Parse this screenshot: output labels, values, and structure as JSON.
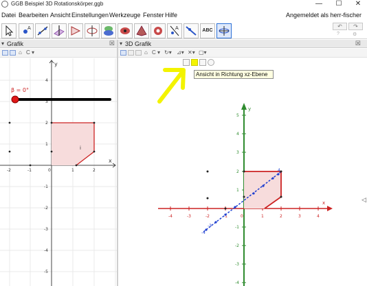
{
  "window": {
    "title": "GGB Beispiel 3D Rotationskörper.ggb",
    "minimize": "—",
    "maximize": "☐",
    "close": "✕"
  },
  "menu": {
    "items": [
      "Datei",
      "Bearbeiten",
      "Ansicht",
      "Einstellungen",
      "Werkzeuge",
      "Fenster",
      "Hilfe"
    ],
    "login": "Angemeldet als herr-fischer"
  },
  "toolbar": {
    "tools": [
      "move-tool",
      "point-tool",
      "line-tool",
      "perpendicular-tool",
      "polygon-tool",
      "circle-tool",
      "intersect-planes-tool",
      "sphere-tool",
      "pyramid-tool",
      "rotate-view-tool",
      "reflect-tool",
      "slider-tool",
      "text-tool",
      "view-rotate-tool"
    ],
    "text_tool_label": "ABC",
    "undo": "↶",
    "redo": "↷"
  },
  "left_panel": {
    "title": "Grafik",
    "style_label": "C",
    "slider_label": "β = 0°",
    "polygon_label": "i",
    "axis_x_label": "x",
    "axis_y_label": "y",
    "x_ticks": [
      "-2",
      "-1",
      "0",
      "1",
      "2"
    ],
    "y_ticks": [
      "4",
      "3",
      "2",
      "1",
      "-1",
      "-2",
      "-3",
      "-4",
      "-5"
    ]
  },
  "right_panel": {
    "title": "3D Grafik",
    "style_label": "C",
    "tooltip": "Ansicht in Richtung xz-Ebene",
    "axis_x_label": "x",
    "axis_y_label": "y",
    "x_ticks": [
      "-4",
      "-3",
      "-2",
      "-1",
      "0",
      "1",
      "2",
      "3",
      "4"
    ],
    "y_ticks": [
      "5",
      "4",
      "3",
      "2",
      "1",
      "-1",
      "-2",
      "-3",
      "-4"
    ],
    "diag_ticks": [
      "4",
      "-3",
      "-4"
    ]
  },
  "colors": {
    "axis_green": "#2e8b2e",
    "axis_red": "#cc2222",
    "polygon_fill": "#f7dcdc",
    "polygon_edge": "#cc2222",
    "highlight": "#f4f400",
    "diag_blue": "#1f3fd0"
  }
}
